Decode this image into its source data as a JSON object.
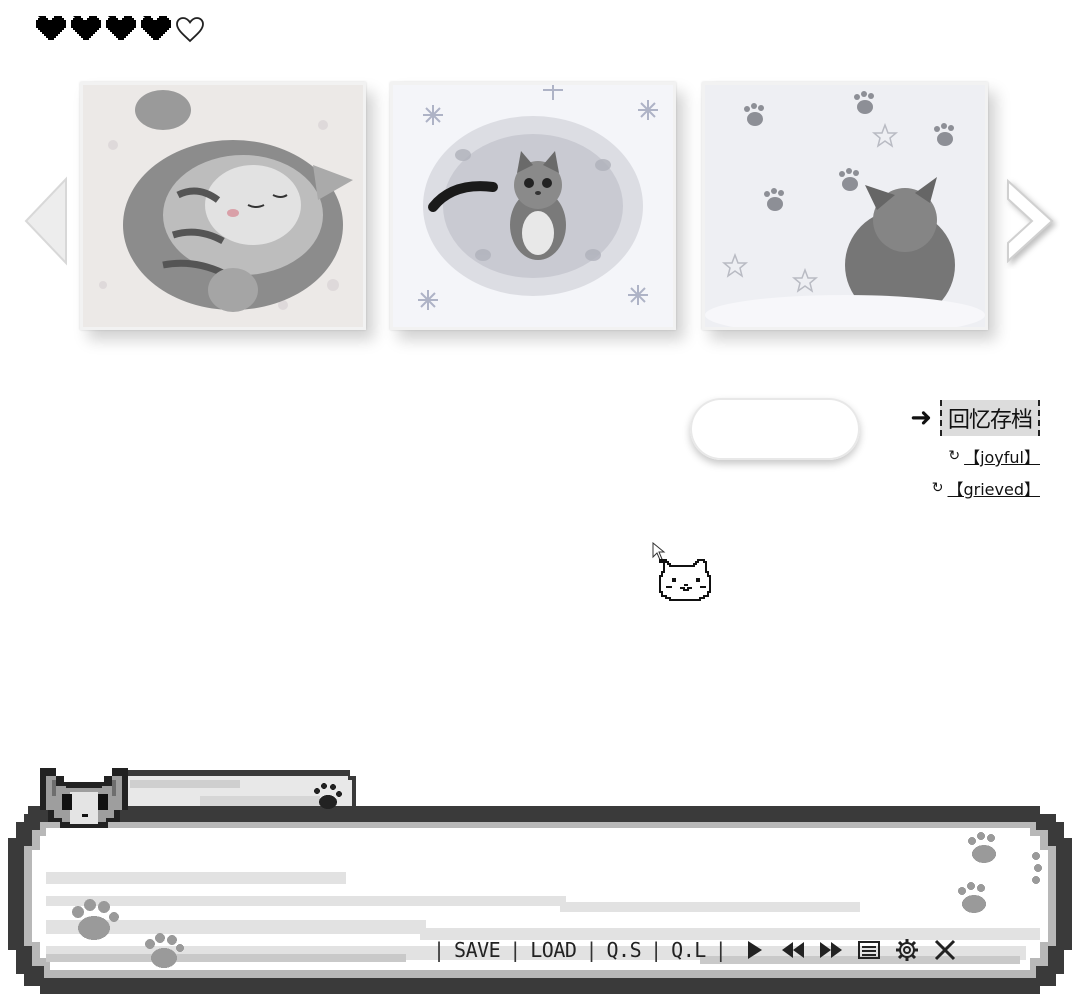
{
  "hud": {
    "lives_full": 4,
    "lives_total": 5,
    "icons": [
      "heart-filled-icon",
      "heart-outline-icon"
    ]
  },
  "gallery": {
    "left_arrow_icon": "chevron-left-icon",
    "right_arrow_icon": "chevron-right-icon",
    "cards": [
      {
        "subject": "sleeping-tabby-kitten"
      },
      {
        "subject": "kitten-in-snowflake-frame"
      },
      {
        "subject": "kitten-in-snow-with-paw-prints"
      }
    ]
  },
  "choices": {
    "pointer": "➜",
    "title": "回忆存档",
    "items": [
      {
        "label": "【joyful】",
        "icon": "↻"
      },
      {
        "label": "【grieved】",
        "icon": "↻"
      }
    ]
  },
  "dialog": {
    "speaker_name": "",
    "text": ""
  },
  "toolbar": {
    "separator": "|",
    "save": "SAVE",
    "load": "LOAD",
    "quick_save": "Q.S",
    "quick_load": "Q.L",
    "icons": [
      "play-icon",
      "rewind-icon",
      "fast-forward-icon",
      "menu-icon",
      "gear-icon",
      "close-icon"
    ]
  },
  "colors": {
    "frame_dark": "#3a3a3a",
    "frame_light": "#d6d6d6",
    "accent": "#111111"
  }
}
